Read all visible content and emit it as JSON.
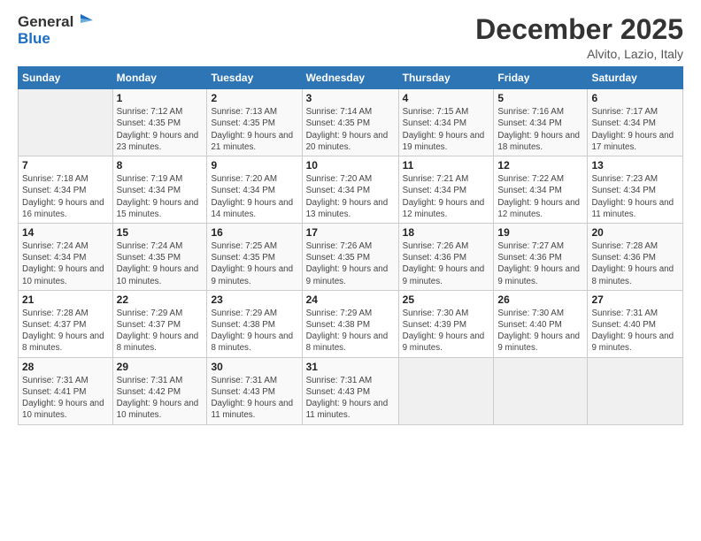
{
  "header": {
    "title": "December 2025",
    "location": "Alvito, Lazio, Italy"
  },
  "logo": {
    "line1": "General",
    "line2": "Blue"
  },
  "columns": [
    "Sunday",
    "Monday",
    "Tuesday",
    "Wednesday",
    "Thursday",
    "Friday",
    "Saturday"
  ],
  "weeks": [
    [
      {
        "day": "",
        "sunrise": "",
        "sunset": "",
        "daylight": "",
        "empty": true
      },
      {
        "day": "1",
        "sunrise": "7:12 AM",
        "sunset": "4:35 PM",
        "daylight": "9 hours and 23 minutes."
      },
      {
        "day": "2",
        "sunrise": "7:13 AM",
        "sunset": "4:35 PM",
        "daylight": "9 hours and 21 minutes."
      },
      {
        "day": "3",
        "sunrise": "7:14 AM",
        "sunset": "4:35 PM",
        "daylight": "9 hours and 20 minutes."
      },
      {
        "day": "4",
        "sunrise": "7:15 AM",
        "sunset": "4:34 PM",
        "daylight": "9 hours and 19 minutes."
      },
      {
        "day": "5",
        "sunrise": "7:16 AM",
        "sunset": "4:34 PM",
        "daylight": "9 hours and 18 minutes."
      },
      {
        "day": "6",
        "sunrise": "7:17 AM",
        "sunset": "4:34 PM",
        "daylight": "9 hours and 17 minutes."
      }
    ],
    [
      {
        "day": "7",
        "sunrise": "7:18 AM",
        "sunset": "4:34 PM",
        "daylight": "9 hours and 16 minutes."
      },
      {
        "day": "8",
        "sunrise": "7:19 AM",
        "sunset": "4:34 PM",
        "daylight": "9 hours and 15 minutes."
      },
      {
        "day": "9",
        "sunrise": "7:20 AM",
        "sunset": "4:34 PM",
        "daylight": "9 hours and 14 minutes."
      },
      {
        "day": "10",
        "sunrise": "7:20 AM",
        "sunset": "4:34 PM",
        "daylight": "9 hours and 13 minutes."
      },
      {
        "day": "11",
        "sunrise": "7:21 AM",
        "sunset": "4:34 PM",
        "daylight": "9 hours and 12 minutes."
      },
      {
        "day": "12",
        "sunrise": "7:22 AM",
        "sunset": "4:34 PM",
        "daylight": "9 hours and 12 minutes."
      },
      {
        "day": "13",
        "sunrise": "7:23 AM",
        "sunset": "4:34 PM",
        "daylight": "9 hours and 11 minutes."
      }
    ],
    [
      {
        "day": "14",
        "sunrise": "7:24 AM",
        "sunset": "4:34 PM",
        "daylight": "9 hours and 10 minutes."
      },
      {
        "day": "15",
        "sunrise": "7:24 AM",
        "sunset": "4:35 PM",
        "daylight": "9 hours and 10 minutes."
      },
      {
        "day": "16",
        "sunrise": "7:25 AM",
        "sunset": "4:35 PM",
        "daylight": "9 hours and 9 minutes."
      },
      {
        "day": "17",
        "sunrise": "7:26 AM",
        "sunset": "4:35 PM",
        "daylight": "9 hours and 9 minutes."
      },
      {
        "day": "18",
        "sunrise": "7:26 AM",
        "sunset": "4:36 PM",
        "daylight": "9 hours and 9 minutes."
      },
      {
        "day": "19",
        "sunrise": "7:27 AM",
        "sunset": "4:36 PM",
        "daylight": "9 hours and 9 minutes."
      },
      {
        "day": "20",
        "sunrise": "7:28 AM",
        "sunset": "4:36 PM",
        "daylight": "9 hours and 8 minutes."
      }
    ],
    [
      {
        "day": "21",
        "sunrise": "7:28 AM",
        "sunset": "4:37 PM",
        "daylight": "9 hours and 8 minutes."
      },
      {
        "day": "22",
        "sunrise": "7:29 AM",
        "sunset": "4:37 PM",
        "daylight": "9 hours and 8 minutes."
      },
      {
        "day": "23",
        "sunrise": "7:29 AM",
        "sunset": "4:38 PM",
        "daylight": "9 hours and 8 minutes."
      },
      {
        "day": "24",
        "sunrise": "7:29 AM",
        "sunset": "4:38 PM",
        "daylight": "9 hours and 8 minutes."
      },
      {
        "day": "25",
        "sunrise": "7:30 AM",
        "sunset": "4:39 PM",
        "daylight": "9 hours and 9 minutes."
      },
      {
        "day": "26",
        "sunrise": "7:30 AM",
        "sunset": "4:40 PM",
        "daylight": "9 hours and 9 minutes."
      },
      {
        "day": "27",
        "sunrise": "7:31 AM",
        "sunset": "4:40 PM",
        "daylight": "9 hours and 9 minutes."
      }
    ],
    [
      {
        "day": "28",
        "sunrise": "7:31 AM",
        "sunset": "4:41 PM",
        "daylight": "9 hours and 10 minutes."
      },
      {
        "day": "29",
        "sunrise": "7:31 AM",
        "sunset": "4:42 PM",
        "daylight": "9 hours and 10 minutes."
      },
      {
        "day": "30",
        "sunrise": "7:31 AM",
        "sunset": "4:43 PM",
        "daylight": "9 hours and 11 minutes."
      },
      {
        "day": "31",
        "sunrise": "7:31 AM",
        "sunset": "4:43 PM",
        "daylight": "9 hours and 11 minutes."
      },
      {
        "day": "",
        "sunrise": "",
        "sunset": "",
        "daylight": "",
        "empty": true
      },
      {
        "day": "",
        "sunrise": "",
        "sunset": "",
        "daylight": "",
        "empty": true
      },
      {
        "day": "",
        "sunrise": "",
        "sunset": "",
        "daylight": "",
        "empty": true
      }
    ]
  ]
}
